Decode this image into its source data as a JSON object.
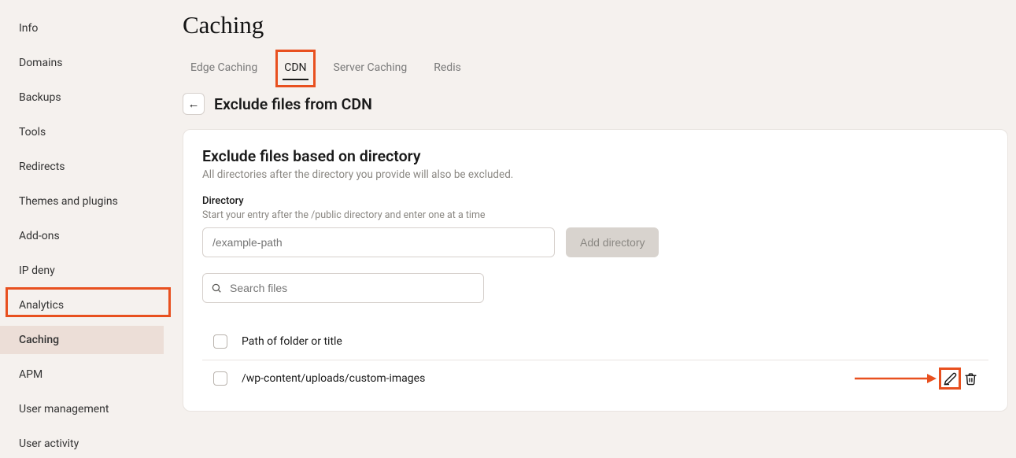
{
  "sidebar": {
    "items": [
      {
        "label": "Info"
      },
      {
        "label": "Domains"
      },
      {
        "label": "Backups"
      },
      {
        "label": "Tools"
      },
      {
        "label": "Redirects"
      },
      {
        "label": "Themes and plugins"
      },
      {
        "label": "Add-ons"
      },
      {
        "label": "IP deny"
      },
      {
        "label": "Analytics"
      },
      {
        "label": "Caching"
      },
      {
        "label": "APM"
      },
      {
        "label": "User management"
      },
      {
        "label": "User activity"
      }
    ],
    "active_index": 9
  },
  "page": {
    "title": "Caching"
  },
  "tabs": {
    "items": [
      {
        "label": "Edge Caching"
      },
      {
        "label": "CDN"
      },
      {
        "label": "Server Caching"
      },
      {
        "label": "Redis"
      }
    ],
    "active_index": 1
  },
  "subheader": {
    "title": "Exclude files from CDN"
  },
  "card": {
    "title": "Exclude files based on directory",
    "desc": "All directories after the directory you provide will also be excluded.",
    "directory_label": "Directory",
    "directory_help": "Start your entry after the /public directory and enter one at a time",
    "directory_placeholder": "/example-path",
    "add_button": "Add directory",
    "search_placeholder": "Search files",
    "list_header": "Path of folder or title",
    "rows": [
      {
        "path": "/wp-content/uploads/custom-images"
      }
    ]
  }
}
